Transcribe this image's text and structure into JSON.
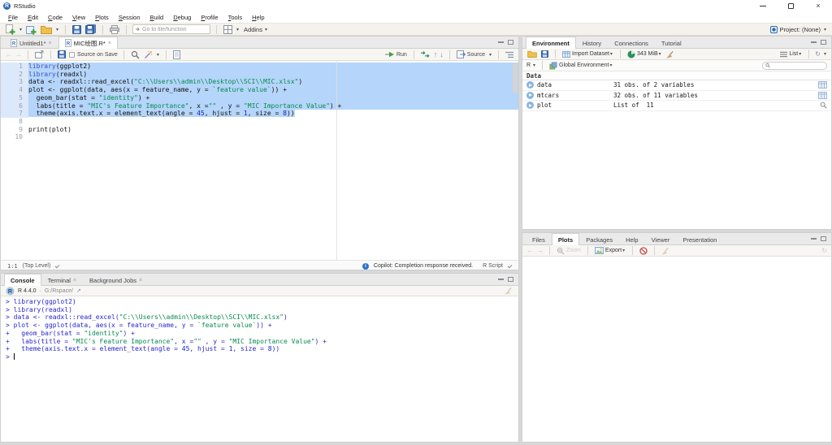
{
  "window": {
    "title": "RStudio"
  },
  "menu": {
    "items": [
      "File",
      "Edit",
      "Code",
      "View",
      "Plots",
      "Session",
      "Build",
      "Debug",
      "Profile",
      "Tools",
      "Help"
    ]
  },
  "toolbar": {
    "goto_placeholder": "Go to file/function",
    "addins": "Addins",
    "project": "Project: (None)"
  },
  "colors": {
    "selection": "#B5D5FA",
    "keyword": "#3E51C6",
    "string": "#068A51",
    "number": "#0D1FC9",
    "console_input": "#2727CC"
  },
  "source": {
    "tabs": [
      {
        "label": "Untitled1*",
        "active": false
      },
      {
        "label": "MIC绘图.R*",
        "active": true
      }
    ],
    "source_on_save": "Source on Save",
    "run": "Run",
    "source_btn": "Source",
    "lines": [
      {
        "n": "1",
        "sel": "full",
        "tokens": [
          [
            "k",
            "library"
          ],
          [
            "p",
            "(ggplot2)"
          ]
        ]
      },
      {
        "n": "2",
        "sel": "full",
        "tokens": [
          [
            "k",
            "library"
          ],
          [
            "p",
            "(readxl)"
          ]
        ]
      },
      {
        "n": "3",
        "sel": "full",
        "tokens": [
          [
            "p",
            "data <- readxl::read_excel("
          ],
          [
            "s",
            "\"C:\\\\Users\\\\admin\\\\Desktop\\\\SCI\\\\MIC.xlsx\""
          ],
          [
            "p",
            ")"
          ]
        ]
      },
      {
        "n": "4",
        "sel": "full",
        "tokens": [
          [
            "p",
            "plot <- ggplot(data, aes(x = feature_name, y = "
          ],
          [
            "s",
            "`feature value`"
          ],
          [
            "p",
            ")) +"
          ]
        ]
      },
      {
        "n": "5",
        "sel": "full",
        "tokens": [
          [
            "p",
            "  geom_bar(stat = "
          ],
          [
            "s",
            "\"identity\""
          ],
          [
            "p",
            ") +"
          ]
        ]
      },
      {
        "n": "6",
        "sel": "full",
        "tokens": [
          [
            "p",
            "  labs(title = "
          ],
          [
            "s",
            "\"MIC's Feature Importance\""
          ],
          [
            "p",
            ", x ="
          ],
          [
            "s",
            "\"\""
          ],
          [
            "p",
            " , y = "
          ],
          [
            "s",
            "\"MIC Importance Value\""
          ],
          [
            "p",
            ") +"
          ]
        ]
      },
      {
        "n": "7",
        "sel": "text",
        "tokens": [
          [
            "p",
            "  theme(axis.text.x = element_text(angle = "
          ],
          [
            "num",
            "45"
          ],
          [
            "p",
            ", hjust = "
          ],
          [
            "num",
            "1"
          ],
          [
            "p",
            ", size = "
          ],
          [
            "num",
            "8"
          ],
          [
            "p",
            "))"
          ]
        ]
      },
      {
        "n": "8",
        "sel": "none",
        "tokens": []
      },
      {
        "n": "9",
        "sel": "none",
        "tokens": [
          [
            "p",
            "print(plot)"
          ]
        ]
      },
      {
        "n": "10",
        "sel": "none",
        "tokens": []
      }
    ],
    "status": {
      "cursor": "1:1",
      "scope": "(Top Level)",
      "copilot": "Copilot: Completion response received.",
      "ftype": "R Script"
    }
  },
  "console": {
    "tabs": [
      {
        "label": "Console",
        "active": true,
        "closable": false
      },
      {
        "label": "Terminal",
        "active": false,
        "closable": true
      },
      {
        "label": "Background Jobs",
        "active": false,
        "closable": true
      }
    ],
    "header": {
      "version": "R 4.4.0",
      "sep": "·",
      "wd": "G:/Rspace/"
    },
    "lines": [
      {
        "tokens": [
          [
            "c",
            "> library(ggplot2)"
          ]
        ]
      },
      {
        "tokens": [
          [
            "c",
            "> library(readxl)"
          ]
        ]
      },
      {
        "tokens": [
          [
            "c",
            "> data <- readxl::read_excel("
          ],
          [
            "s",
            "\"C:\\\\Users\\\\admin\\\\Desktop\\\\SCI\\\\MIC.xlsx\""
          ],
          [
            "c",
            ")"
          ]
        ]
      },
      {
        "tokens": [
          [
            "c",
            "> plot <- ggplot(data, aes(x = feature_name, y = "
          ],
          [
            "s",
            "`feature value`"
          ],
          [
            "c",
            ")) +"
          ]
        ]
      },
      {
        "tokens": [
          [
            "c",
            "+   geom_bar(stat = "
          ],
          [
            "s",
            "\"identity\""
          ],
          [
            "c",
            ") +"
          ]
        ]
      },
      {
        "tokens": [
          [
            "c",
            "+   labs(title = "
          ],
          [
            "s",
            "\"MIC's Feature Importance\""
          ],
          [
            "c",
            ", x ="
          ],
          [
            "s",
            "\"\""
          ],
          [
            "c",
            " , y = "
          ],
          [
            "s",
            "\"MIC Importance Value\""
          ],
          [
            "c",
            ") +"
          ]
        ]
      },
      {
        "tokens": [
          [
            "c",
            "+   theme(axis.text.x = element_text(angle = "
          ],
          [
            "num",
            "45"
          ],
          [
            "c",
            ", hjust = "
          ],
          [
            "num",
            "1"
          ],
          [
            "c",
            ", size = "
          ],
          [
            "num",
            "8"
          ],
          [
            "c",
            "))"
          ]
        ]
      },
      {
        "tokens": [
          [
            "c",
            "> "
          ]
        ],
        "cursor": true
      }
    ]
  },
  "environment": {
    "tabs": [
      {
        "label": "Environment",
        "active": true
      },
      {
        "label": "History",
        "active": false
      },
      {
        "label": "Connections",
        "active": false
      },
      {
        "label": "Tutorial",
        "active": false
      }
    ],
    "toolbar": {
      "import": "Import Dataset",
      "memory": "343 MiB",
      "list": "List"
    },
    "scope_row": {
      "r": "R",
      "env": "Global Environment"
    },
    "section": "Data",
    "objects": [
      {
        "name": "data",
        "desc": "31 obs. of 2 variables",
        "action": "table"
      },
      {
        "name": "mtcars",
        "desc": "32 obs. of 11 variables",
        "action": "table"
      },
      {
        "name": "plot",
        "desc": "List of  11",
        "action": "magnifier"
      }
    ]
  },
  "files": {
    "tabs": [
      {
        "label": "Files",
        "active": false
      },
      {
        "label": "Plots",
        "active": true
      },
      {
        "label": "Packages",
        "active": false
      },
      {
        "label": "Help",
        "active": false
      },
      {
        "label": "Viewer",
        "active": false
      },
      {
        "label": "Presentation",
        "active": false
      }
    ],
    "toolbar": {
      "zoom": "Zoom",
      "export": "Export"
    }
  }
}
